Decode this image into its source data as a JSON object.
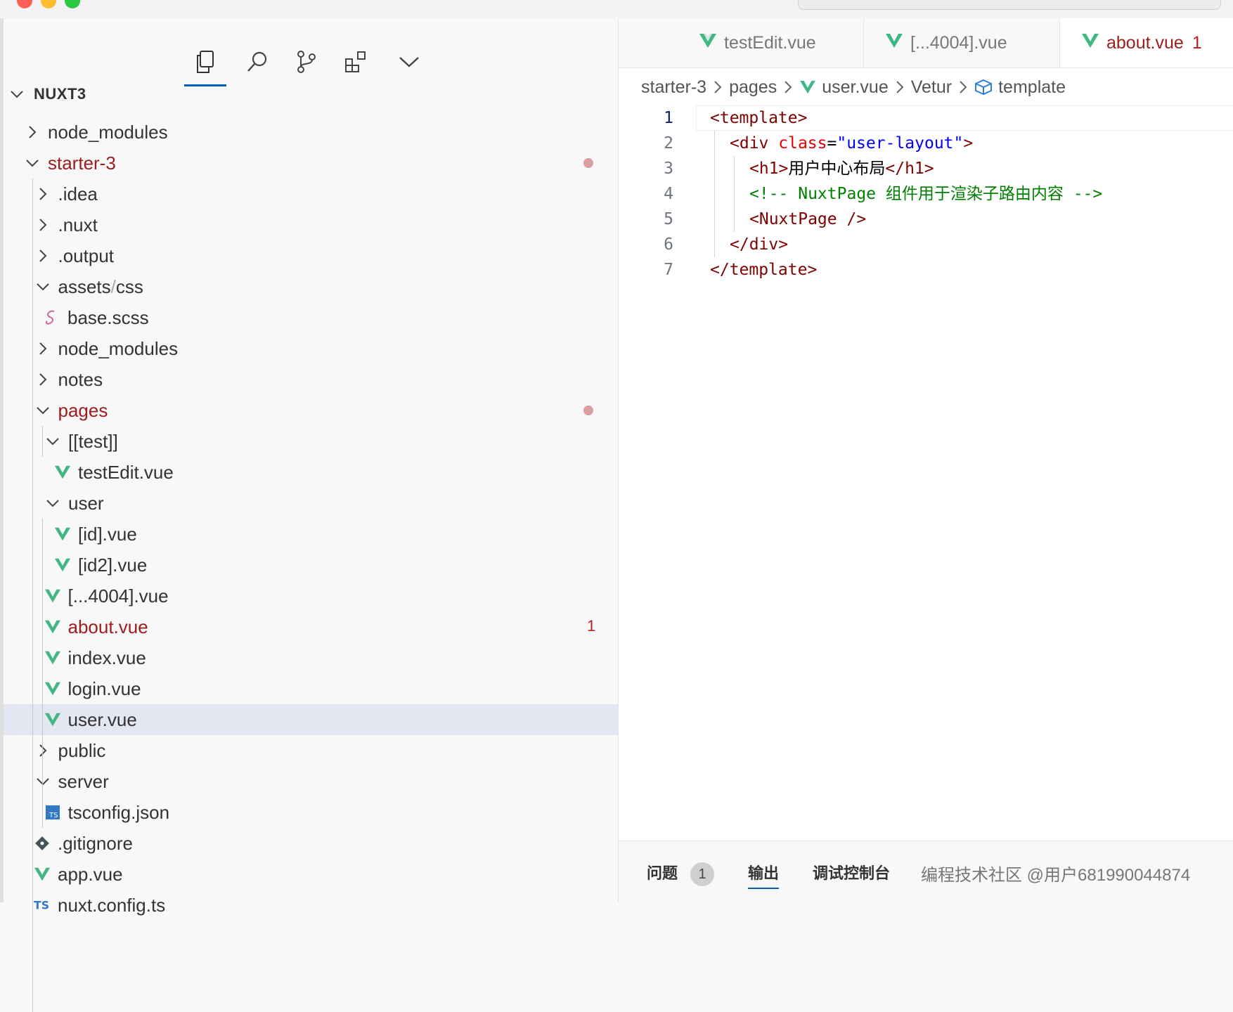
{
  "window": {
    "traffic_colors": [
      "#ff5f57",
      "#febc2e",
      "#28c840"
    ]
  },
  "sidebar": {
    "activity_icons": [
      "explorer-icon",
      "search-icon",
      "source-control-icon",
      "extensions-icon",
      "chevron-down-icon"
    ],
    "root_label": "NUXT3",
    "items": [
      {
        "label": "node_modules",
        "type": "folder",
        "open": false
      },
      {
        "label": "starter-3",
        "type": "folder",
        "open": true,
        "modified": true
      },
      {
        "label": ".idea",
        "type": "folder",
        "open": false
      },
      {
        "label": ".nuxt",
        "type": "folder",
        "open": false
      },
      {
        "label": ".output",
        "type": "folder",
        "open": false
      },
      {
        "label": "assets",
        "label2": "css",
        "type": "folder",
        "open": true
      },
      {
        "label": "base.scss",
        "type": "scss"
      },
      {
        "label": "node_modules",
        "type": "folder",
        "open": false
      },
      {
        "label": "notes",
        "type": "folder",
        "open": false
      },
      {
        "label": "pages",
        "type": "folder",
        "open": true,
        "modified": true
      },
      {
        "label": "[[test]]",
        "type": "folder",
        "open": true
      },
      {
        "label": "testEdit.vue",
        "type": "vue"
      },
      {
        "label": "user",
        "type": "folder",
        "open": true
      },
      {
        "label": "[id].vue",
        "type": "vue"
      },
      {
        "label": "[id2].vue",
        "type": "vue"
      },
      {
        "label": "[...4004].vue",
        "type": "vue"
      },
      {
        "label": "about.vue",
        "type": "vue",
        "modified": true,
        "count": "1"
      },
      {
        "label": "index.vue",
        "type": "vue"
      },
      {
        "label": "login.vue",
        "type": "vue"
      },
      {
        "label": "user.vue",
        "type": "vue",
        "selected": true
      },
      {
        "label": "public",
        "type": "folder",
        "open": false
      },
      {
        "label": "server",
        "type": "folder",
        "open": true
      },
      {
        "label": "tsconfig.json",
        "type": "tsconfig"
      },
      {
        "label": ".gitignore",
        "type": "git"
      },
      {
        "label": "app.vue",
        "type": "vue"
      },
      {
        "label": "nuxt.config.ts",
        "type": "ts"
      }
    ]
  },
  "tabs": [
    {
      "label": "testEdit.vue"
    },
    {
      "label": "[...4004].vue"
    },
    {
      "label": "about.vue",
      "count": "1"
    }
  ],
  "breadcrumbs": [
    "starter-3",
    "pages",
    "user.vue",
    "Vetur",
    "template"
  ],
  "code": {
    "line_numbers": [
      "1",
      "2",
      "3",
      "4",
      "5",
      "6",
      "7"
    ],
    "l1": "<template>",
    "l2_open": "<div ",
    "l2_attr": "class",
    "l2_eq": "=",
    "l2_str": "\"user-layout\"",
    "l2_close": ">",
    "l3_open": "<h1>",
    "l3_text": "用户中心布局",
    "l3_close": "</h1>",
    "l4": "<!-- NuxtPage 组件用于渲染子路由内容 -->",
    "l5": "<NuxtPage />",
    "l6": "</div>",
    "l7": "</template>"
  },
  "panel": {
    "problems_label": "问题",
    "problems_count": "1",
    "output_label": "输出",
    "debug_label": "调试控制台",
    "watermark": "编程技术社区 @用户681990044874"
  },
  "colors": {
    "accent": "#005fb8",
    "modified": "#9d1c1c",
    "vue_green": "#41b883",
    "selection": "#e4e6f1"
  }
}
